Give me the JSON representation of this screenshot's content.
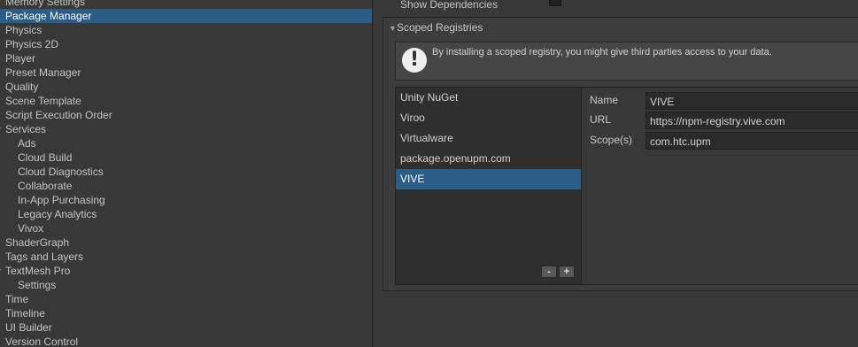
{
  "sidebar": {
    "items": [
      {
        "label": "Memory Settings",
        "level": 0,
        "selected": false
      },
      {
        "label": "Package Manager",
        "level": 0,
        "selected": true
      },
      {
        "label": "Physics",
        "level": 0,
        "selected": false
      },
      {
        "label": "Physics 2D",
        "level": 0,
        "selected": false
      },
      {
        "label": "Player",
        "level": 0,
        "selected": false
      },
      {
        "label": "Preset Manager",
        "level": 0,
        "selected": false
      },
      {
        "label": "Quality",
        "level": 0,
        "selected": false
      },
      {
        "label": "Scene Template",
        "level": 0,
        "selected": false
      },
      {
        "label": "Script Execution Order",
        "level": 0,
        "selected": false
      },
      {
        "label": "Services",
        "level": 0,
        "selected": false,
        "foldout": true
      },
      {
        "label": "Ads",
        "level": 1,
        "selected": false
      },
      {
        "label": "Cloud Build",
        "level": 1,
        "selected": false
      },
      {
        "label": "Cloud Diagnostics",
        "level": 1,
        "selected": false
      },
      {
        "label": "Collaborate",
        "level": 1,
        "selected": false
      },
      {
        "label": "In-App Purchasing",
        "level": 1,
        "selected": false
      },
      {
        "label": "Legacy Analytics",
        "level": 1,
        "selected": false
      },
      {
        "label": "Vivox",
        "level": 1,
        "selected": false
      },
      {
        "label": "ShaderGraph",
        "level": 0,
        "selected": false
      },
      {
        "label": "Tags and Layers",
        "level": 0,
        "selected": false
      },
      {
        "label": "TextMesh Pro",
        "level": 0,
        "selected": false,
        "foldout": true
      },
      {
        "label": "Settings",
        "level": 1,
        "selected": false
      },
      {
        "label": "Time",
        "level": 0,
        "selected": false
      },
      {
        "label": "Timeline",
        "level": 0,
        "selected": false
      },
      {
        "label": "UI Builder",
        "level": 0,
        "selected": false
      },
      {
        "label": "Version Control",
        "level": 0,
        "selected": false
      }
    ]
  },
  "settings": {
    "show_dependencies_label": "Show Dependencies",
    "show_dependencies_checked": false
  },
  "scoped": {
    "header": "Scoped Registries",
    "warning_icon": "exclamation-icon",
    "warning_text": "By installing a scoped registry, you might give third parties access to your data.",
    "registries": [
      {
        "label": "Unity NuGet",
        "selected": false
      },
      {
        "label": "Viroo",
        "selected": false
      },
      {
        "label": "Virtualware",
        "selected": false
      },
      {
        "label": "package.openupm.com",
        "selected": false
      },
      {
        "label": "VIVE",
        "selected": true
      }
    ],
    "remove_label": "-",
    "add_label": "+",
    "details": {
      "name_label": "Name",
      "name_value": "VIVE",
      "url_label": "URL",
      "url_value": "https://npm-registry.vive.com",
      "scopes_label": "Scope(s)",
      "scopes_value": "com.htc.upm"
    }
  },
  "colors": {
    "selection": "#2c5d87",
    "background": "#383838"
  }
}
